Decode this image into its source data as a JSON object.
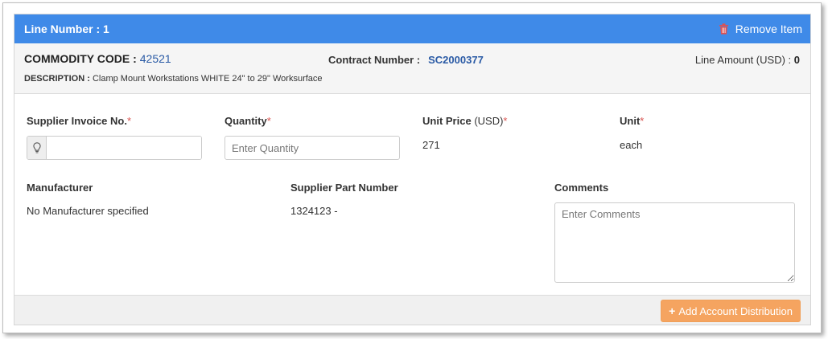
{
  "header": {
    "title": "Line Number : 1",
    "remove_label": "Remove Item"
  },
  "info": {
    "commodity_label": "COMMODITY CODE :",
    "commodity_value": "42521",
    "description_label": "DESCRIPTION :",
    "description_value": "Clamp Mount Workstations WHITE 24\" to 29\" Worksurface",
    "contract_label": "Contract Number :",
    "contract_value": "SC2000377",
    "line_amount_label": "Line Amount (USD) :",
    "line_amount_value": "0"
  },
  "form": {
    "supplier_invoice_label": "Supplier Invoice No.",
    "supplier_invoice_value": "",
    "quantity_label": "Quantity",
    "quantity_placeholder": "Enter Quantity",
    "unit_price_label": "Unit Price",
    "unit_price_currency": "(USD)",
    "unit_price_value": "271",
    "unit_label": "Unit",
    "unit_value": "each",
    "manufacturer_label": "Manufacturer",
    "manufacturer_value": "No Manufacturer specified",
    "supplier_part_label": "Supplier Part Number",
    "supplier_part_value": "1324123 -",
    "comments_label": "Comments",
    "comments_placeholder": "Enter Comments",
    "required_marker": "*"
  },
  "footer": {
    "add_distribution_label": "Add Account Distribution"
  },
  "colors": {
    "header_blue": "#3f8ae8",
    "link_blue": "#2a5aa5",
    "required_red": "#d9534f",
    "trash_red": "#e05050",
    "button_orange": "#f5a460"
  },
  "icons": {
    "remove": "trash-icon",
    "invoice_addon": "lightbulb-icon",
    "add": "plus-icon"
  }
}
